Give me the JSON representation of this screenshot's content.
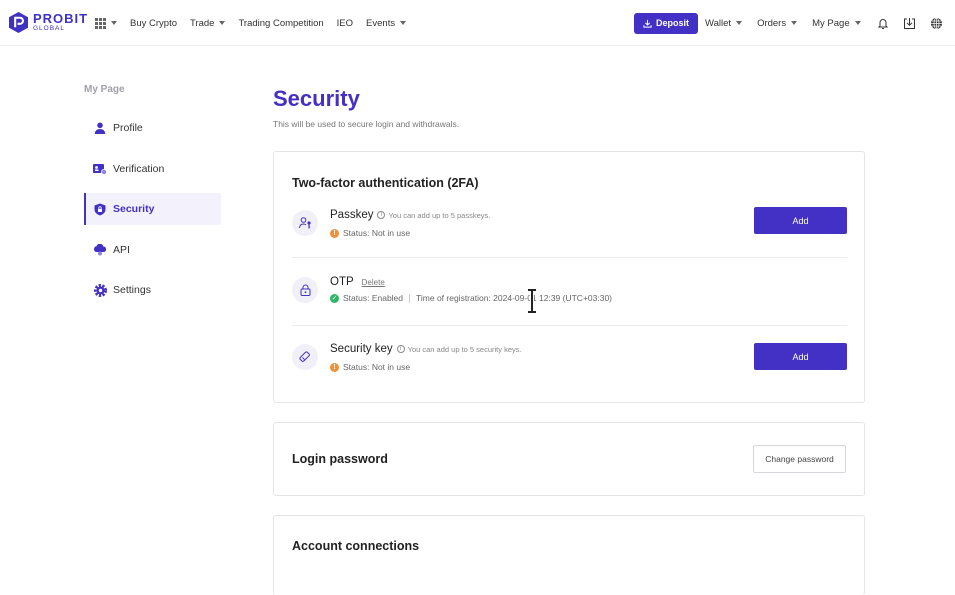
{
  "brand": {
    "name": "PROBIT",
    "sub": "GLOBAL",
    "accent": "#4330c4"
  },
  "nav": {
    "left": [
      {
        "label": "Buy Crypto",
        "dropdown": false
      },
      {
        "label": "Trade",
        "dropdown": true
      },
      {
        "label": "Trading Competition",
        "dropdown": false
      },
      {
        "label": "IEO",
        "dropdown": false
      },
      {
        "label": "Events",
        "dropdown": true
      }
    ],
    "deposit_label": "Deposit",
    "right": [
      {
        "label": "Wallet",
        "dropdown": true
      },
      {
        "label": "Orders",
        "dropdown": true
      },
      {
        "label": "My Page",
        "dropdown": true
      }
    ],
    "icons": [
      "bell-icon",
      "download-icon",
      "globe-icon"
    ]
  },
  "sidebar": {
    "title": "My Page",
    "items": [
      {
        "label": "Profile",
        "icon": "user-icon",
        "active": false
      },
      {
        "label": "Verification",
        "icon": "id-card-icon",
        "active": false
      },
      {
        "label": "Security",
        "icon": "shield-icon",
        "active": true
      },
      {
        "label": "API",
        "icon": "cloud-icon",
        "active": false
      },
      {
        "label": "Settings",
        "icon": "gear-icon",
        "active": false
      }
    ]
  },
  "main": {
    "title": "Security",
    "subtitle": "This will be used to secure login and withdrawals.",
    "twofa": {
      "title": "Two-factor authentication (2FA)",
      "passkey": {
        "name": "Passkey",
        "hint": "You can add up to 5 passkeys.",
        "status": "Status: Not in use",
        "button": "Add"
      },
      "otp": {
        "name": "OTP",
        "delete": "Delete",
        "status": "Status: Enabled",
        "registration": "Time of registration: 2024-09-01 12:39 (UTC+03:30)"
      },
      "security_key": {
        "name": "Security key",
        "hint": "You can add up to 5 security keys.",
        "status": "Status: Not in use",
        "button": "Add"
      }
    },
    "login_password": {
      "title": "Login password",
      "button": "Change password"
    },
    "account_connections": {
      "title": "Account connections"
    }
  }
}
